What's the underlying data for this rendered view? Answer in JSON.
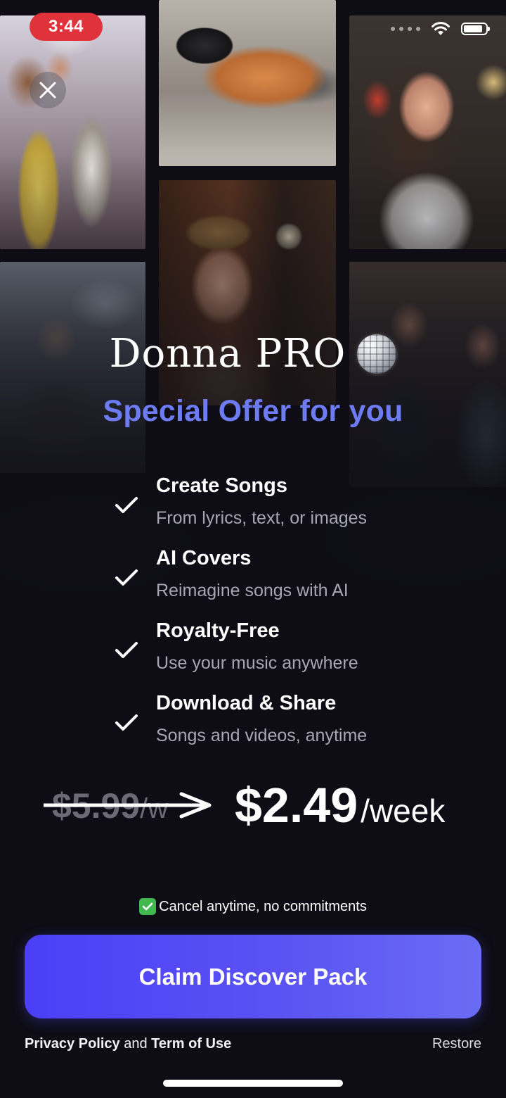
{
  "status_bar": {
    "time": "3:44"
  },
  "close_icon": "close-icon",
  "header": {
    "title": "Donna PRO",
    "title_icon": "disco-ball-icon",
    "subtitle": "Special Offer for you"
  },
  "features": [
    {
      "title": "Create Songs",
      "description": "From lyrics, text, or images"
    },
    {
      "title": "AI Covers",
      "description": "Reimagine songs with AI"
    },
    {
      "title": "Royalty-Free",
      "description": "Use your music anywhere"
    },
    {
      "title": "Download & Share",
      "description": "Songs and videos, anytime"
    }
  ],
  "pricing": {
    "old_price": "$5.99",
    "old_period": "/w",
    "new_price": "$2.49",
    "new_period": "/week"
  },
  "cancel_note": "Cancel anytime, no commitments",
  "cta_label": "Claim Discover Pack",
  "footer": {
    "privacy": "Privacy Policy",
    "and": " and ",
    "terms": "Term of Use",
    "restore": "Restore"
  },
  "colors": {
    "background": "#0e0d15",
    "accent": "#5a52f3",
    "subtitle": "#6d7cf2",
    "status_time_bg": "#e0323a"
  }
}
